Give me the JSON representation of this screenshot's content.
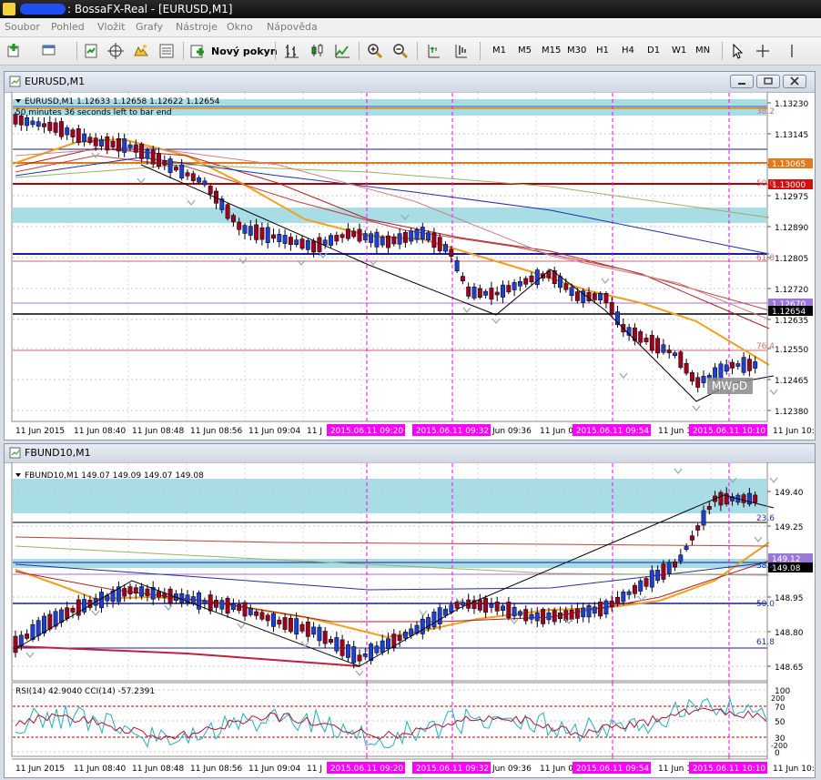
{
  "app": {
    "title": ": BossaFX-Real - [EURUSD,M1]"
  },
  "menu": [
    "Soubor",
    "Pohled",
    "Vložit",
    "Grafy",
    "Nástroje",
    "Okno",
    "Nápověda"
  ],
  "toolbar": {
    "new_order_label": "Nový pokyn",
    "timeframes": [
      "M1",
      "M5",
      "M15",
      "M30",
      "H1",
      "H4",
      "D1",
      "W1",
      "MN"
    ]
  },
  "eurusd": {
    "window_title": "EURUSD,M1",
    "info_line": "EURUSD,M1  1.12633 1.12658 1.12622 1.12654",
    "countdown": "50 minutes 36 seconds left to bar end",
    "price_ticks": [
      "1.13230",
      "1.13145",
      "1.13060",
      "1.12975",
      "1.12890",
      "1.12805",
      "1.12720",
      "1.12635",
      "1.12550",
      "1.12465",
      "1.12380"
    ],
    "labels": {
      "fib382": "38.2",
      "fib50": "50.0",
      "fib618": "61.8",
      "fib764": "76.4",
      "watermark": "MWpD"
    },
    "price_boxes": {
      "orange": "1.13065",
      "red": "1.13000",
      "violet": "1.12670",
      "current": "1.12654"
    },
    "time_labels": [
      "11 Jun 2015",
      "11 Jun 08:40",
      "11 Jun 08:48",
      "11 Jun 08:56",
      "11 Jun 09:04",
      "11 J",
      "20",
      "Jun 09:36",
      "11 Jun 09",
      "11 Jun 10",
      "11 Jun 10:1"
    ],
    "time_markers": [
      "2015.06.11 09:20",
      "2015.06.11 09:32",
      "2015.06.11 09:54",
      "2015.06.11 10:10"
    ]
  },
  "fbund": {
    "window_title": "FBUND10,M1",
    "info_line": "FBUND10,M1  149.07 149.09 149.07 149.08",
    "price_ticks": [
      "149.40",
      "149.25",
      "148.95",
      "148.80",
      "148.65"
    ],
    "labels": {
      "fib236": "23.6",
      "fib382": "38.2",
      "fib50": "50.0",
      "fib618": "61.8"
    },
    "price_boxes": {
      "violet": "149.12",
      "current": "149.08"
    },
    "rsi_label": "RSI(14) 42.9040  CCI(14) -57.2391",
    "rsi_ticks": [
      "100",
      "70",
      "50",
      "30",
      "0"
    ],
    "rsi_extra": [
      "200",
      "-200"
    ],
    "time_labels": [
      "11 Jun 2015",
      "11 Jun 08:40",
      "11 Jun 08:48",
      "11 Jun 08:56",
      "11 Jun 09:04",
      "11 J",
      "20",
      "Jun 09:36",
      "11 Jun 09",
      "11 Jun 10",
      "11 Jun 10:1"
    ],
    "time_markers": [
      "2015.06.11 09:20",
      "2015.06.11 09:32",
      "2015.06.11 09:54",
      "2015.06.11 10:10"
    ]
  },
  "colors": {
    "bull": "#1f3fd0",
    "bear": "#a00020",
    "ma": "#f0a020",
    "zone": "#a8dde6",
    "marker": "#ff00ff"
  }
}
